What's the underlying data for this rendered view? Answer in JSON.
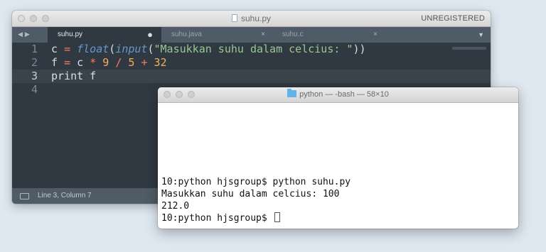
{
  "editor": {
    "title": "suhu.py",
    "license_label": "UNREGISTERED",
    "tabs": [
      {
        "label": "suhu.py",
        "active": true,
        "modified": true
      },
      {
        "label": "suhu.java",
        "active": false
      },
      {
        "label": "suhu.c",
        "active": false
      }
    ],
    "tab_close_glyph": "×",
    "tab_modified_glyph": "●",
    "line_numbers": [
      "1",
      "2",
      "3",
      "4"
    ],
    "current_line": 3,
    "status": "Line 3, Column 7",
    "colors": {
      "background": "#303841",
      "tab_bar": "#4f5b66",
      "operator": "#f97b58",
      "function": "#6699cc",
      "string": "#99c794",
      "number": "#f9ae58",
      "text": "#d8dee9"
    }
  },
  "code": {
    "line1": {
      "var": "c",
      "eq": "=",
      "fn1": "float",
      "open1": "(",
      "fn2": "input",
      "open2": "(",
      "str": "\"Masukkan suhu dalam celcius: \"",
      "close": "))"
    },
    "line2": {
      "var": "f",
      "eq": "=",
      "a": "c",
      "mul": "*",
      "n1": "9",
      "div": "/",
      "n2": "5",
      "add": "+",
      "n3": "32"
    },
    "line3": "print f",
    "line4": ""
  },
  "terminal": {
    "title": "python — -bash — 58×10",
    "lines": [
      "10:python hjsgroup$ python suhu.py",
      "Masukkan suhu dalam celcius: 100",
      "212.0",
      "10:python hjsgroup$ "
    ]
  },
  "icons": {
    "file": "file-icon",
    "folder": "folder-icon",
    "status_panel": "panel-icon"
  }
}
